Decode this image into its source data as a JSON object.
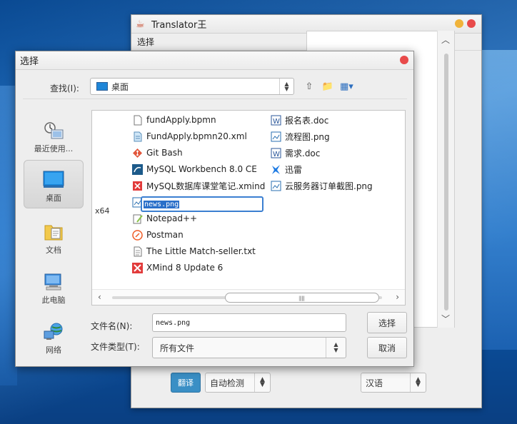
{
  "main_window": {
    "title": "Translator王",
    "menu_label": "选择",
    "translate_button": "翻译",
    "source_lang": "自动检测",
    "target_lang": "汉语"
  },
  "dialog": {
    "title": "选择",
    "look_in_label": "查找(I):",
    "look_in_value": "桌面",
    "places": [
      {
        "label": "最近使用...",
        "icon": "recent-icon"
      },
      {
        "label": "桌面",
        "icon": "desktop-icon"
      },
      {
        "label": "文档",
        "icon": "documents-icon"
      },
      {
        "label": "此电脑",
        "icon": "computer-icon"
      },
      {
        "label": "网络",
        "icon": "network-icon"
      }
    ],
    "partial_column_label": "x64",
    "files_col1": [
      {
        "name": "fundApply.bpmn",
        "icon": "file-icon"
      },
      {
        "name": "FundApply.bpmn20.xml",
        "icon": "xml-file-icon"
      },
      {
        "name": "Git Bash",
        "icon": "git-icon"
      },
      {
        "name": "MySQL Workbench 8.0 CE",
        "icon": "mysql-icon"
      },
      {
        "name": "MySQL数据库课堂笔记.xmind",
        "icon": "xmind-file-icon"
      },
      {
        "name": "Notepad++",
        "icon": "notepad-icon"
      },
      {
        "name": "Postman",
        "icon": "postman-icon"
      },
      {
        "name": "The Little Match-seller.txt",
        "icon": "text-file-icon"
      },
      {
        "name": "XMind 8 Update 6",
        "icon": "xmind-icon"
      }
    ],
    "files_col2": [
      {
        "name": "报名表.doc",
        "icon": "doc-icon"
      },
      {
        "name": "流程图.png",
        "icon": "image-icon"
      },
      {
        "name": "需求.doc",
        "icon": "doc-icon"
      },
      {
        "name": "迅雷",
        "icon": "thunder-icon"
      },
      {
        "name": "云服务器订单截图.png",
        "icon": "image-icon"
      }
    ],
    "rename_value": "news.png",
    "file_name_label": "文件名(N):",
    "file_name_value": "news.png",
    "file_type_label": "文件类型(T):",
    "file_type_value": "所有文件",
    "select_button": "选择",
    "cancel_button": "取消"
  }
}
